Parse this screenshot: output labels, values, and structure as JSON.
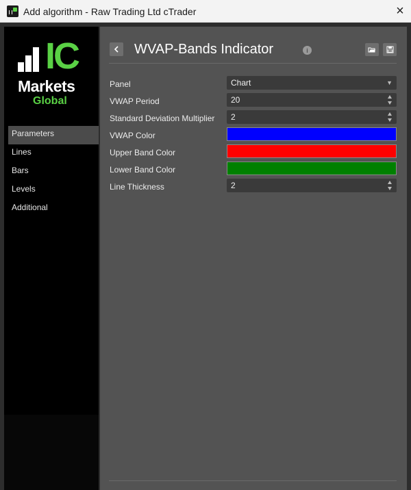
{
  "window": {
    "title": "Add algorithm - Raw Trading Ltd cTrader",
    "close_icon": "×"
  },
  "logo": {
    "ic": "IC",
    "markets": "Markets",
    "global": "Global",
    "accent_color": "#5ad145"
  },
  "sidebar": {
    "items": [
      {
        "label": "Parameters",
        "active": true
      },
      {
        "label": "Lines"
      },
      {
        "label": "Bars"
      },
      {
        "label": "Levels"
      },
      {
        "label": "Additional"
      }
    ]
  },
  "header": {
    "title": "WVAP-Bands Indicator",
    "back_icon": "chevron-left-icon",
    "info_icon": "info-icon",
    "tools": [
      "open-folder-icon",
      "save-icon"
    ]
  },
  "params": [
    {
      "label": "Panel",
      "value": "Chart",
      "kind": "select"
    },
    {
      "label": "VWAP Period",
      "value": "20",
      "kind": "number"
    },
    {
      "label": "Standard Deviation Multiplier",
      "value": "2",
      "kind": "number"
    },
    {
      "label": "VWAP Color",
      "color": "#0000ff",
      "kind": "color"
    },
    {
      "label": "Upper Band Color",
      "color": "#ff0000",
      "kind": "color"
    },
    {
      "label": "Lower Band Color",
      "color": "#008000",
      "kind": "color"
    },
    {
      "label": "Line Thickness",
      "value": "2",
      "kind": "number"
    }
  ]
}
